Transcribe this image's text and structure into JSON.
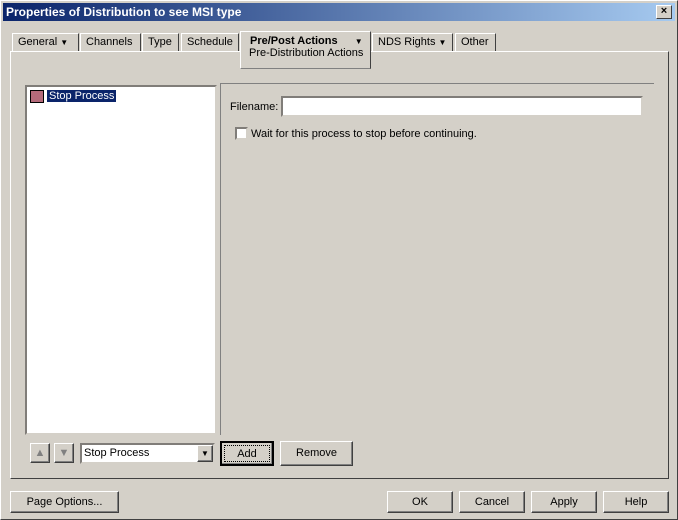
{
  "window": {
    "title": "Properties of Distribution to see MSI type",
    "close": "×"
  },
  "tabs": [
    {
      "label": "General",
      "dropdown": true
    },
    {
      "label": "Channels"
    },
    {
      "label": "Type"
    },
    {
      "label": "Schedule"
    },
    {
      "label": "Pre/Post Actions",
      "dropdown": true,
      "subtitle": "Pre-Distribution Actions",
      "active": true
    },
    {
      "label": "NDS Rights",
      "dropdown": true
    },
    {
      "label": "Other"
    }
  ],
  "list": {
    "items": [
      "Stop Process"
    ]
  },
  "form": {
    "filename_label": "Filename:",
    "filename_value": "",
    "checkbox_label": "Wait for this process to stop before continuing.",
    "checkbox_checked": false
  },
  "bottom": {
    "select_value": "Stop Process",
    "add": "Add",
    "remove": "Remove"
  },
  "footer": {
    "page_options": "Page Options...",
    "ok": "OK",
    "cancel": "Cancel",
    "apply": "Apply",
    "help": "Help"
  }
}
